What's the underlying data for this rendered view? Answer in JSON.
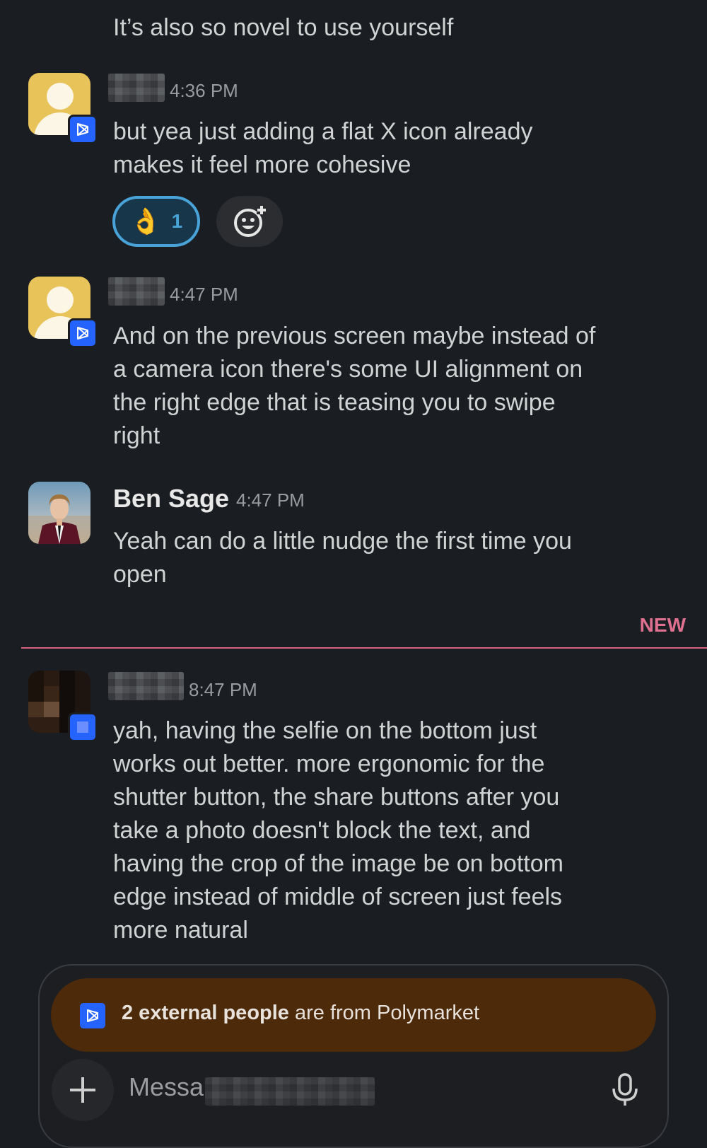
{
  "colors": {
    "background": "#1a1d21",
    "external_badge": "#2563ff",
    "reaction_border": "#4aa3d8",
    "new_divider": "#d6617f",
    "banner_bg": "#4d2a0a"
  },
  "messages": [
    {
      "text": "It’s also so novel to use yourself"
    },
    {
      "time": "4:36 PM",
      "text_lines": [
        "but yea just adding a flat X icon already",
        "makes it feel more cohesive"
      ],
      "reaction": {
        "emoji": "👌",
        "count": "1"
      },
      "add_reaction_icon": "add-emoji-icon"
    },
    {
      "time": "4:47 PM",
      "text_lines": [
        "And on the previous screen maybe instead of",
        "a camera icon there's some UI alignment on",
        "the right edge that is teasing you to swipe",
        "right"
      ]
    },
    {
      "sender": "Ben Sage",
      "time": "4:47 PM",
      "text_lines": [
        "Yeah can do a little nudge the first time you",
        "open"
      ]
    },
    {
      "time": "8:47 PM",
      "text_lines": [
        "yah, having the selfie on the bottom just",
        "works out better. more ergonomic for the",
        "shutter button, the share buttons after you",
        "take a photo doesn't block the text, and",
        "having the crop of the image be on bottom",
        "edge instead of middle of screen just feels",
        "more natural"
      ]
    }
  ],
  "new_divider_label": "NEW",
  "banner": {
    "bold": "2 external people",
    "rest": " are from Polymarket"
  },
  "composer": {
    "placeholder_visible": "Messa",
    "plus_icon": "plus-icon",
    "mic_icon": "microphone-icon"
  }
}
